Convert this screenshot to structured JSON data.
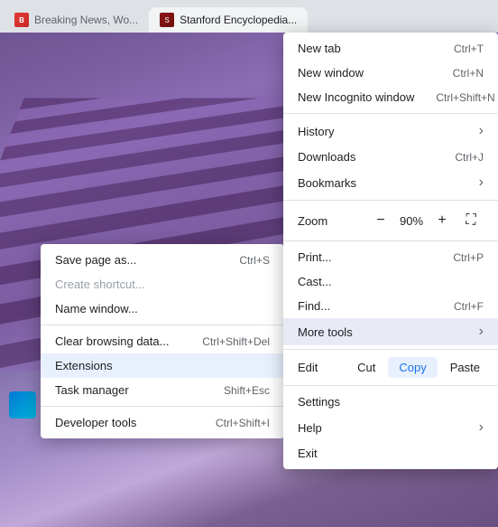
{
  "browser": {
    "tabs": [
      {
        "label": "Breaking News, Wo...",
        "favicon_type": "breaking",
        "active": false
      },
      {
        "label": "Stanford Encyclopedia...",
        "favicon_type": "stanford",
        "active": true
      }
    ]
  },
  "context_menu_left": {
    "items": [
      {
        "label": "Save page as...",
        "shortcut": "Ctrl+S",
        "disabled": false,
        "separator_after": false
      },
      {
        "label": "Create shortcut...",
        "shortcut": "",
        "disabled": true,
        "separator_after": false
      },
      {
        "label": "Name window...",
        "shortcut": "",
        "disabled": false,
        "separator_after": true
      },
      {
        "label": "Clear browsing data...",
        "shortcut": "Ctrl+Shift+Del",
        "disabled": false,
        "separator_after": false
      },
      {
        "label": "Extensions",
        "shortcut": "",
        "disabled": false,
        "highlighted": true,
        "separator_after": false
      },
      {
        "label": "Task manager",
        "shortcut": "Shift+Esc",
        "disabled": false,
        "separator_after": true
      },
      {
        "label": "Developer tools",
        "shortcut": "Ctrl+Shift+I",
        "disabled": false,
        "separator_after": false
      }
    ]
  },
  "context_menu_right": {
    "items_top": [
      {
        "id": "new-tab",
        "label": "New tab",
        "shortcut": "Ctrl+T",
        "has_arrow": false
      },
      {
        "id": "new-window",
        "label": "New window",
        "shortcut": "Ctrl+N",
        "has_arrow": false
      },
      {
        "id": "new-incognito",
        "label": "New Incognito window",
        "shortcut": "Ctrl+Shift+N",
        "has_arrow": false
      }
    ],
    "separator_1": true,
    "items_mid": [
      {
        "id": "history",
        "label": "History",
        "shortcut": "",
        "has_arrow": true
      },
      {
        "id": "downloads",
        "label": "Downloads",
        "shortcut": "Ctrl+J",
        "has_arrow": false
      },
      {
        "id": "bookmarks",
        "label": "Bookmarks",
        "shortcut": "",
        "has_arrow": true
      }
    ],
    "separator_2": true,
    "zoom": {
      "label": "Zoom",
      "minus": "−",
      "value": "90%",
      "plus": "+",
      "fullscreen": "⛶"
    },
    "items_lower": [
      {
        "id": "print",
        "label": "Print...",
        "shortcut": "Ctrl+P",
        "has_arrow": false
      },
      {
        "id": "cast",
        "label": "Cast...",
        "shortcut": "",
        "has_arrow": false
      },
      {
        "id": "find",
        "label": "Find...",
        "shortcut": "Ctrl+F",
        "has_arrow": false
      },
      {
        "id": "more-tools",
        "label": "More tools",
        "shortcut": "",
        "has_arrow": true,
        "highlighted": true
      }
    ],
    "separator_3": true,
    "edit_row": {
      "label": "Edit",
      "cut": "Cut",
      "copy": "Copy",
      "paste": "Paste"
    },
    "separator_4": true,
    "items_bottom": [
      {
        "id": "settings",
        "label": "Settings",
        "shortcut": "",
        "has_arrow": false
      },
      {
        "id": "help",
        "label": "Help",
        "shortcut": "",
        "has_arrow": true
      },
      {
        "id": "exit",
        "label": "Exit",
        "shortcut": "",
        "has_arrow": false
      }
    ]
  }
}
